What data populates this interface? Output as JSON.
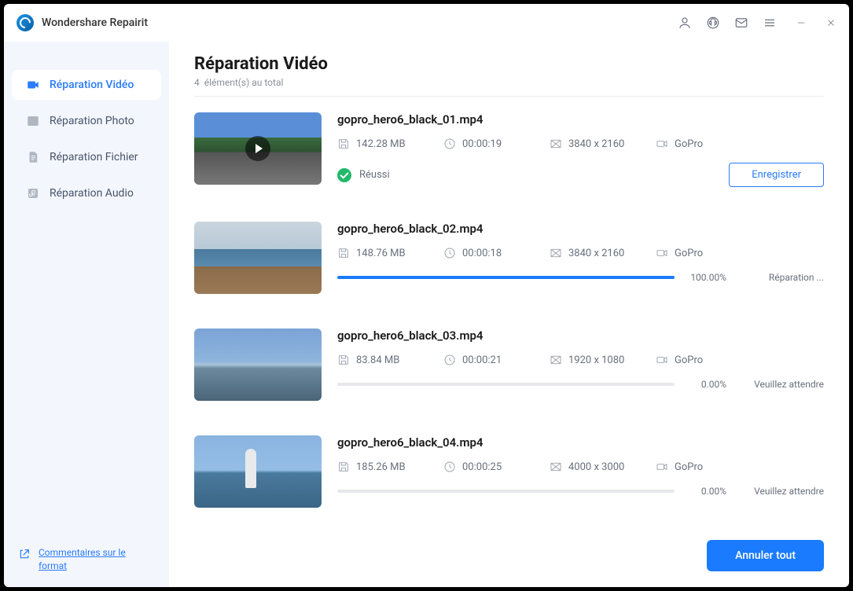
{
  "app": {
    "title": "Wondershare Repairit"
  },
  "sidebar": {
    "items": [
      {
        "label": "Réparation Vidéo"
      },
      {
        "label": "Réparation Photo"
      },
      {
        "label": "Réparation Fichier"
      },
      {
        "label": "Réparation Audio"
      }
    ],
    "feedback": "Commentaires sur le format"
  },
  "header": {
    "title": "Réparation Vidéo",
    "count": "4",
    "count_suffix": "élément(s) au total"
  },
  "labels": {
    "save": "Enregistrer",
    "cancel_all": "Annuler tout",
    "success": "Réussi",
    "repairing": "Réparation ...",
    "waiting": "Veuillez attendre"
  },
  "items": [
    {
      "name": "gopro_hero6_black_01.mp4",
      "size": "142.28  MB",
      "duration": "00:00:19",
      "resolution": "3840 x 2160",
      "device": "GoPro",
      "state": "done"
    },
    {
      "name": "gopro_hero6_black_02.mp4",
      "size": "148.76  MB",
      "duration": "00:00:18",
      "resolution": "3840 x 2160",
      "device": "GoPro",
      "state": "progress",
      "percent": "100.00%",
      "fill": 100
    },
    {
      "name": "gopro_hero6_black_03.mp4",
      "size": "83.84  MB",
      "duration": "00:00:21",
      "resolution": "1920 x 1080",
      "device": "GoPro",
      "state": "wait",
      "percent": "0.00%",
      "fill": 0
    },
    {
      "name": "gopro_hero6_black_04.mp4",
      "size": "185.26  MB",
      "duration": "00:00:25",
      "resolution": "4000 x 3000",
      "device": "GoPro",
      "state": "wait",
      "percent": "0.00%",
      "fill": 0
    }
  ]
}
